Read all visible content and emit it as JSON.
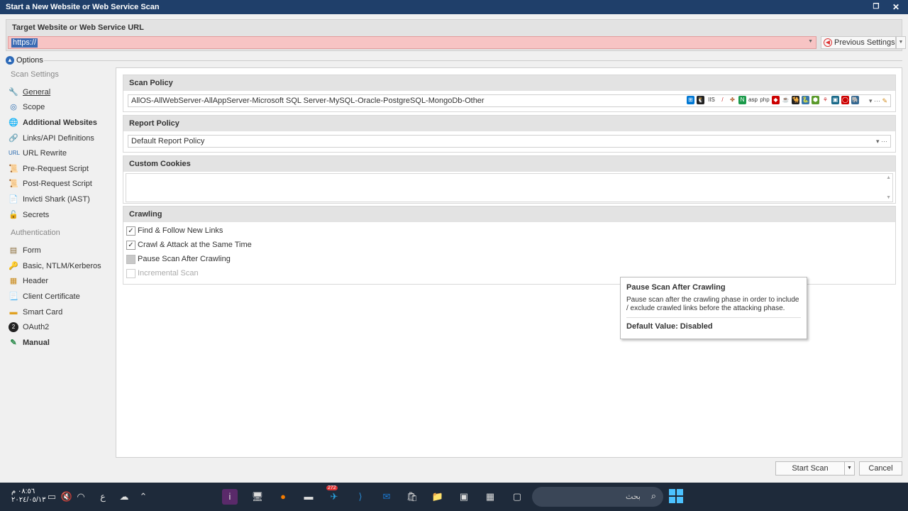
{
  "window": {
    "title": "Start a New Website or Web Service Scan"
  },
  "target": {
    "label": "Target Website or Web Service URL",
    "value": "https://",
    "previous_settings": "Previous Settings"
  },
  "options_label": "Options",
  "sidebar": {
    "scan_settings_header": "Scan Settings",
    "scan_items": [
      {
        "label": "General"
      },
      {
        "label": "Scope"
      },
      {
        "label": "Additional Websites"
      },
      {
        "label": "Links/API Definitions"
      },
      {
        "label": "URL Rewrite"
      },
      {
        "label": "Pre-Request Script"
      },
      {
        "label": "Post-Request Script"
      },
      {
        "label": "Invicti Shark (IAST)"
      },
      {
        "label": "Secrets"
      }
    ],
    "auth_header": "Authentication",
    "auth_items": [
      {
        "label": "Form"
      },
      {
        "label": "Basic, NTLM/Kerberos"
      },
      {
        "label": "Header"
      },
      {
        "label": "Client Certificate"
      },
      {
        "label": "Smart Card"
      },
      {
        "label": "OAuth2"
      },
      {
        "label": "Manual"
      }
    ]
  },
  "scan_policy": {
    "header": "Scan Policy",
    "value": "AllOS-AllWebServer-AllAppServer-Microsoft SQL Server-MySQL-Oracle-PostgreSQL-MongoDb-Other"
  },
  "report_policy": {
    "header": "Report Policy",
    "value": "Default Report Policy"
  },
  "custom_cookies": {
    "header": "Custom Cookies"
  },
  "crawling": {
    "header": "Crawling",
    "options": [
      {
        "label": "Find & Follow New Links"
      },
      {
        "label": "Crawl & Attack at the Same Time"
      },
      {
        "label": "Pause Scan After Crawling"
      },
      {
        "label": "Incremental Scan"
      }
    ]
  },
  "tooltip": {
    "title": "Pause Scan After Crawling",
    "body": "Pause scan after the crawling phase in order to include / exclude crawled links before the attacking phase.",
    "default": "Default Value: Disabled"
  },
  "buttons": {
    "start": "Start Scan",
    "cancel": "Cancel"
  },
  "taskbar": {
    "time": "٠٨:٥٦ م",
    "date": "٢٠٢٤/٠٥/١٣",
    "lang": "ع",
    "search": "بحث",
    "badge": "272"
  }
}
